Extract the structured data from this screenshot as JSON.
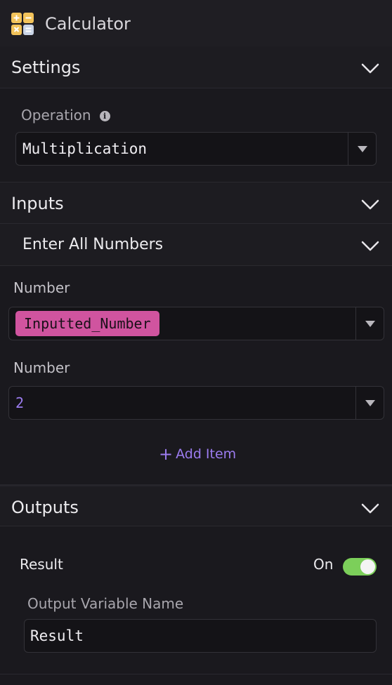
{
  "app": {
    "title": "Calculator",
    "icon": "calculator-icon"
  },
  "settings": {
    "header": "Settings",
    "operation_label": "Operation",
    "operation_value": "Multiplication"
  },
  "inputs": {
    "header": "Inputs",
    "subheader": "Enter All Numbers",
    "items": [
      {
        "label": "Number",
        "value": "Inputted_Number",
        "is_variable": true
      },
      {
        "label": "Number",
        "value": "2",
        "is_variable": false
      }
    ],
    "add_item_label": "Add Item"
  },
  "outputs": {
    "header": "Outputs",
    "result_label": "Result",
    "toggle_label": "On",
    "toggle_on": true,
    "variable_name_label": "Output Variable Name",
    "variable_name_value": "Result"
  },
  "colors": {
    "accent": "#9c7cf0",
    "variable_tag": "#d0549f",
    "toggle_on": "#7ccf5a",
    "background": "#1a191e"
  }
}
